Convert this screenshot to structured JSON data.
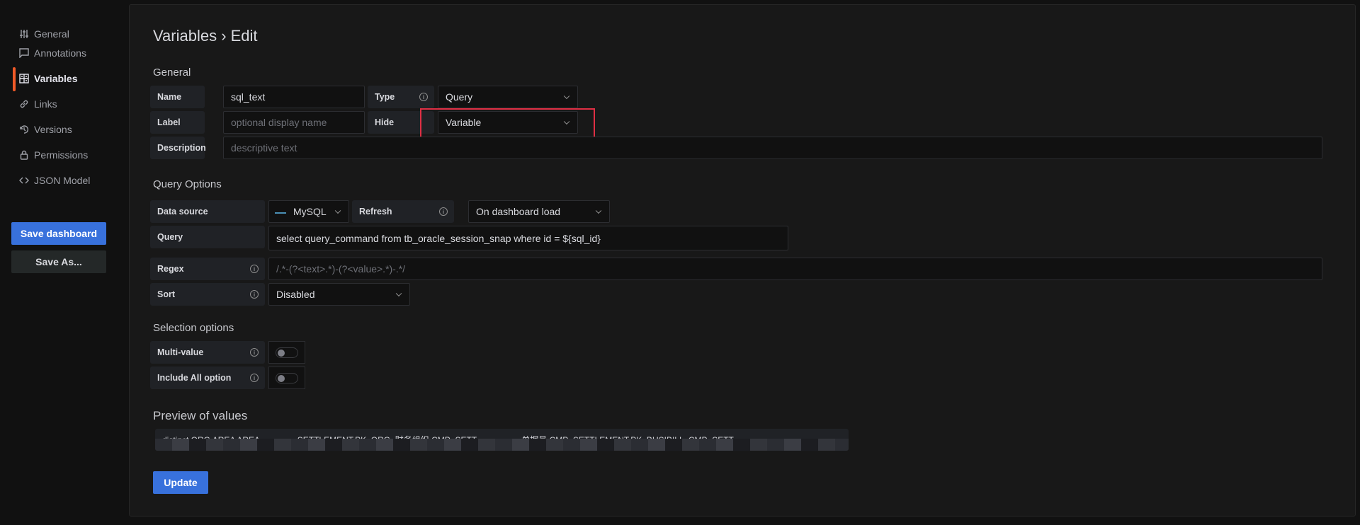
{
  "sidebar": {
    "items": [
      {
        "label": "General",
        "icon": "sliders-icon"
      },
      {
        "label": "Annotations",
        "icon": "comment-icon"
      },
      {
        "label": "Variables",
        "icon": "calculator-icon",
        "active": true
      },
      {
        "label": "Links",
        "icon": "link-icon"
      },
      {
        "label": "Versions",
        "icon": "history-icon"
      },
      {
        "label": "Permissions",
        "icon": "lock-icon"
      },
      {
        "label": "JSON Model",
        "icon": "code-icon"
      }
    ],
    "save_dashboard": "Save dashboard",
    "save_as": "Save As..."
  },
  "colors": {
    "accent": "#3871dc",
    "active_bar": "#f05a28",
    "highlight_box": "#e02f44"
  },
  "page": {
    "title": "Variables › Edit"
  },
  "general": {
    "heading": "General",
    "name_label": "Name",
    "name_value": "sql_text",
    "type_label": "Type",
    "type_value": "Query",
    "label_label": "Label",
    "label_placeholder": "optional display name",
    "hide_label": "Hide",
    "hide_value": "Variable",
    "description_label": "Description",
    "description_placeholder": "descriptive text"
  },
  "query_options": {
    "heading": "Query Options",
    "datasource_label": "Data source",
    "datasource_value": "MySQL",
    "refresh_label": "Refresh",
    "refresh_value": "On dashboard load",
    "query_label": "Query",
    "query_value": "select query_command from tb_oracle_session_snap where id = ${sql_id}",
    "regex_label": "Regex",
    "regex_placeholder": "/.*-(?<text>.*)-(?<value>.*)-.*/",
    "sort_label": "Sort",
    "sort_value": "Disabled"
  },
  "selection": {
    "heading": "Selection options",
    "multi_label": "Multi-value",
    "multi_on": false,
    "all_label": "Include All option",
    "all_on": false
  },
  "preview": {
    "heading": "Preview of values",
    "value": "distinct ORG AREA AREA                SETTLEMENT.PK_ORG  财务组织 CMP_SETT                   单据号 CMP_SETTLEMENT.PK_BUSIBILL  CMP_SETT"
  },
  "update": "Update"
}
